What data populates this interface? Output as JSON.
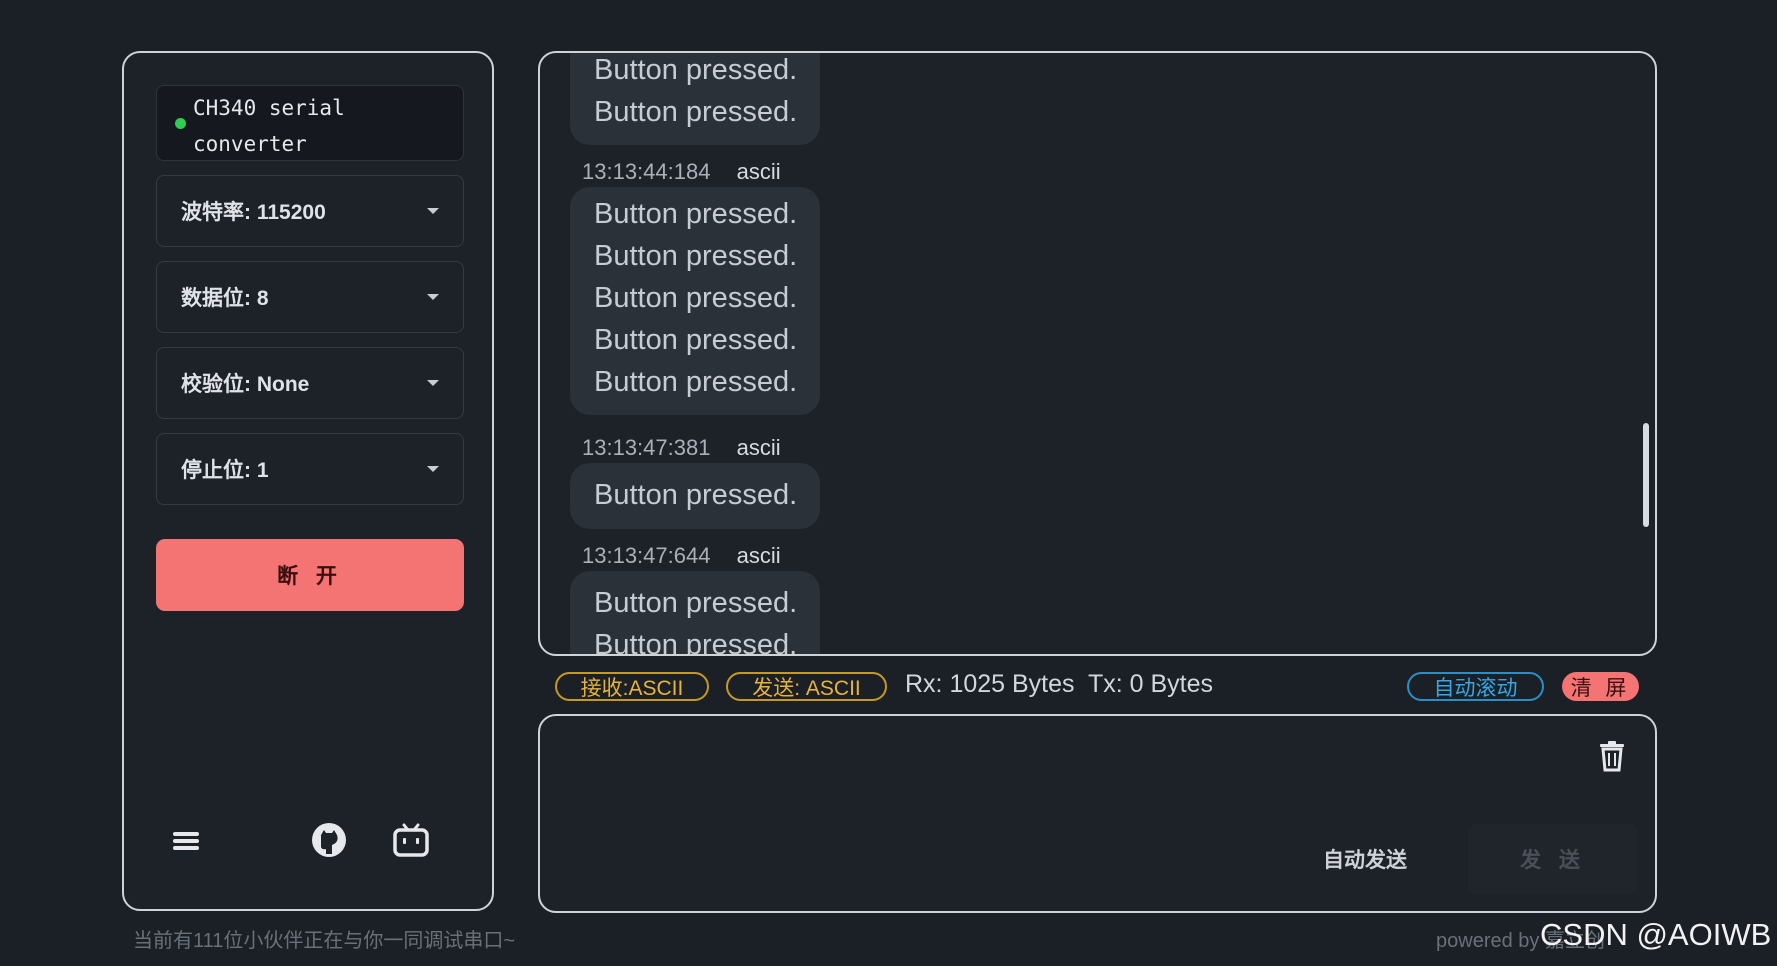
{
  "sidebar": {
    "device_name_line1": "CH340 serial",
    "device_name_line2": "converter",
    "baud_label": "波特率: 115200",
    "data_bits_label": "数据位: 8",
    "parity_label": "校验位: None",
    "stop_bits_label": "停止位: 1",
    "disconnect_label": "断 开",
    "icons": [
      "menu-icon",
      "github-icon",
      "bilibili-icon"
    ],
    "status_color": "#2ecc51"
  },
  "receive": {
    "top_partial": [
      "Button pressed.",
      "Button pressed."
    ],
    "messages": [
      {
        "time": "13:13:44:184",
        "encoding": "ascii",
        "lines": [
          "Button pressed.",
          "Button pressed.",
          "Button pressed.",
          "Button pressed.",
          "Button pressed."
        ]
      },
      {
        "time": "13:13:47:381",
        "encoding": "ascii",
        "lines": [
          "Button pressed."
        ]
      },
      {
        "time": "13:13:47:644",
        "encoding": "ascii",
        "lines": [
          "Button pressed.",
          "Button pressed."
        ]
      }
    ]
  },
  "status_bar": {
    "rx_mode": "接收:ASCII",
    "tx_mode": "发送: ASCII",
    "rx_bytes": "Rx: 1025 Bytes",
    "tx_bytes": "Tx: 0 Bytes",
    "auto_scroll": "自动滚动",
    "clear": "清 屏"
  },
  "send": {
    "input_value": "",
    "auto_send_label": "自动发送",
    "send_label": "发 送"
  },
  "footer": {
    "left_text": "当前有111位小伙伴正在与你一同调试串口~",
    "right_text": "powered by 嘉立创",
    "watermark": "CSDN @AOIWB"
  },
  "colors": {
    "background": "#1b2027",
    "danger": "#f47474",
    "warning": "#e8b33a",
    "info": "#36a7e6"
  }
}
